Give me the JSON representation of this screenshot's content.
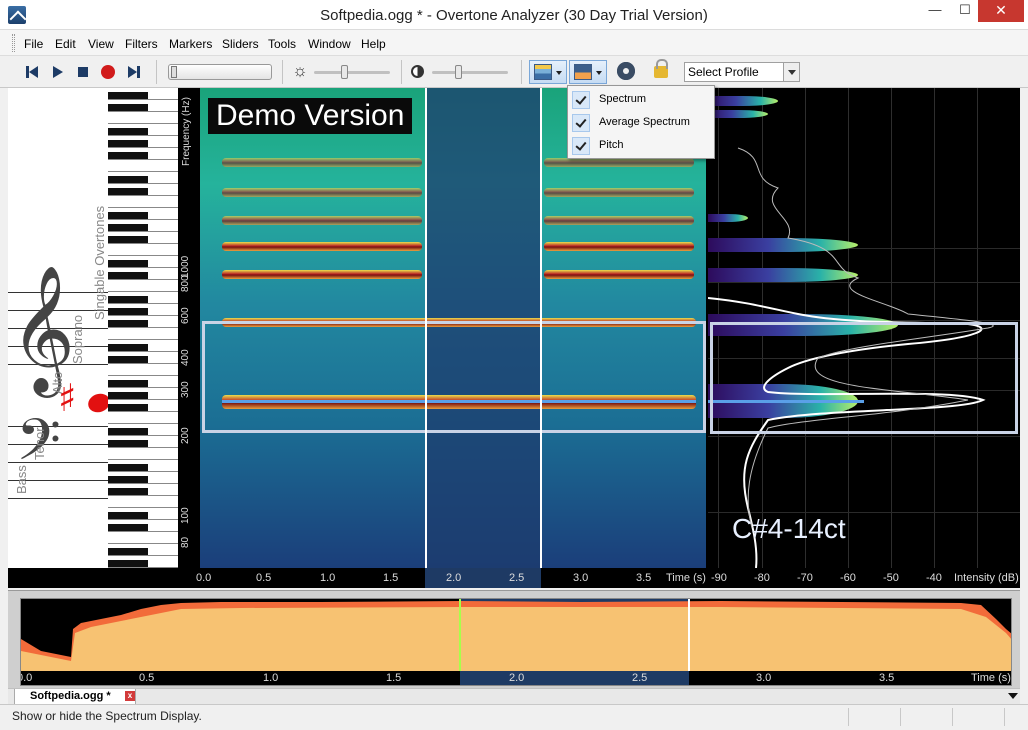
{
  "window": {
    "title": "Softpedia.ogg * - Overtone Analyzer (30 Day Trial Version)",
    "minimize": "—",
    "maximize": "☐",
    "close": "✕"
  },
  "menu": {
    "items": [
      "File",
      "Edit",
      "View",
      "Filters",
      "Markers",
      "Sliders",
      "Tools",
      "Window",
      "Help"
    ]
  },
  "toolbar": {
    "profile_select": "Select Profile"
  },
  "view_menu": {
    "items": [
      {
        "label": "Spectrum",
        "checked": true
      },
      {
        "label": "Average Spectrum",
        "checked": true
      },
      {
        "label": "Pitch",
        "checked": true
      }
    ]
  },
  "keyboard": {
    "labels": [
      "Bass",
      "Tenor",
      "Alto",
      "Soprano",
      "Singable Overtones"
    ]
  },
  "spectrogram": {
    "demo_label": "Demo Version",
    "freq_title": "Frequency (Hz)",
    "freq_ticks": [
      "1000",
      "800",
      "600",
      "400",
      "300",
      "200",
      "100",
      "80"
    ],
    "time_ticks": [
      "0.0",
      "0.5",
      "1.0",
      "1.5",
      "2.0",
      "2.5",
      "3.0",
      "3.5"
    ],
    "time_unit": "Time (s)"
  },
  "spectrum": {
    "note": "C#4-14ct",
    "ticks": [
      "-90",
      "-80",
      "-70",
      "-60",
      "-50",
      "-40"
    ],
    "unit": "Intensity (dB)"
  },
  "overview": {
    "ticks": [
      "0.0",
      "0.5",
      "1.0",
      "1.5",
      "2.0",
      "2.5",
      "3.0",
      "3.5"
    ],
    "unit": "Time (s)"
  },
  "tabs": {
    "file_tab": "Softpedia.ogg *",
    "close": "x"
  },
  "status": {
    "text": "Show or hide the Spectrum Display."
  },
  "colors": {
    "selection": "#1e3a64",
    "pitch": "#5aa0e8",
    "wave_outer": "#f26b3a",
    "wave_inner": "#f7c272",
    "close_button": "#c7372f"
  }
}
